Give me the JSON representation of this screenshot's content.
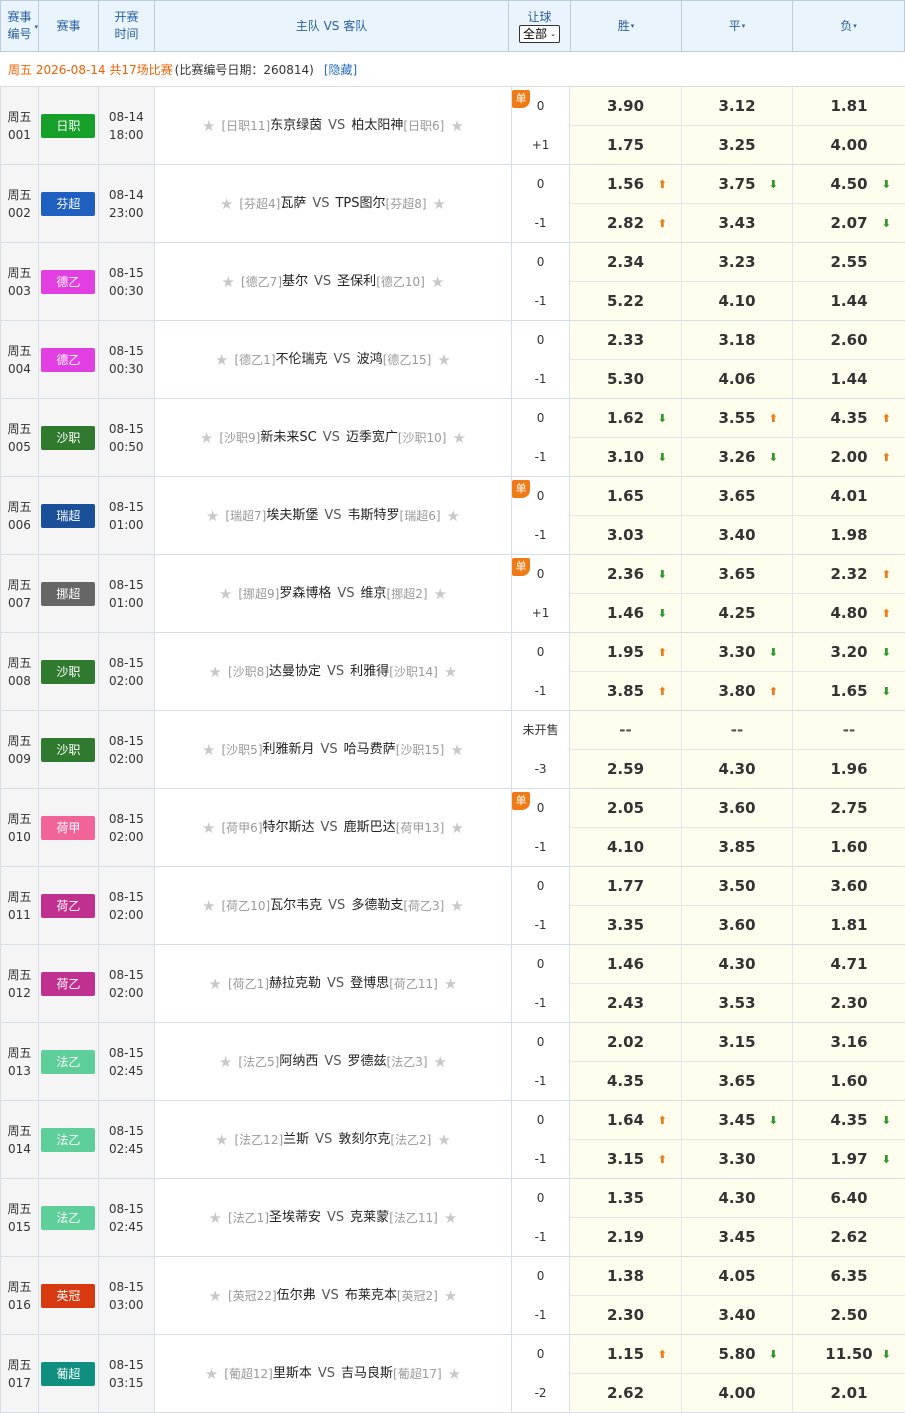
{
  "header": {
    "col_id": "赛事\n编号",
    "col_league": "赛事",
    "col_time": "开赛\n时间",
    "col_match": "主队 VS 客队",
    "col_hc": "让球",
    "hc_select": "全部",
    "col_win": "胜",
    "col_draw": "平",
    "col_lose": "负"
  },
  "info": {
    "prefix": "周五 2026-08-14 共17场比赛",
    "note": "(比赛编号日期：260814)",
    "link": "[隐藏]"
  },
  "vs": "VS",
  "matches": [
    {
      "day": "周五",
      "num": "001",
      "league": "日职",
      "color": "#16a02a",
      "date": "08-14",
      "time": "18:00",
      "hrank": "[日职11]",
      "home": "东京绿茵",
      "away": "柏太阳神",
      "arank": "[日职6]",
      "dan": "单",
      "h1": "0",
      "h2": "+1",
      "o1": [
        "3.90",
        "3.12",
        "1.81"
      ],
      "t1": [
        "",
        "",
        ""
      ],
      "o2": [
        "1.75",
        "3.25",
        "4.00"
      ],
      "t2": [
        "",
        "",
        ""
      ]
    },
    {
      "day": "周五",
      "num": "002",
      "league": "芬超",
      "color": "#1f5fbf",
      "date": "08-14",
      "time": "23:00",
      "hrank": "[芬超4]",
      "home": "瓦萨",
      "away": "TPS图尔",
      "arank": "[芬超8]",
      "dan": "",
      "h1": "0",
      "h2": "-1",
      "o1": [
        "1.56",
        "3.75",
        "4.50"
      ],
      "t1": [
        "up",
        "dn",
        "dn"
      ],
      "o2": [
        "2.82",
        "3.43",
        "2.07"
      ],
      "t2": [
        "up",
        "",
        "dn"
      ]
    },
    {
      "day": "周五",
      "num": "003",
      "league": "德乙",
      "color": "#e23fe2",
      "date": "08-15",
      "time": "00:30",
      "hrank": "[德乙7]",
      "home": "基尔",
      "away": "圣保利",
      "arank": "[德乙10]",
      "dan": "",
      "h1": "0",
      "h2": "-1",
      "o1": [
        "2.34",
        "3.23",
        "2.55"
      ],
      "t1": [
        "",
        "",
        ""
      ],
      "o2": [
        "5.22",
        "4.10",
        "1.44"
      ],
      "t2": [
        "",
        "",
        ""
      ]
    },
    {
      "day": "周五",
      "num": "004",
      "league": "德乙",
      "color": "#e23fe2",
      "date": "08-15",
      "time": "00:30",
      "hrank": "[德乙1]",
      "home": "不伦瑞克",
      "away": "波鸿",
      "arank": "[德乙15]",
      "dan": "",
      "h1": "0",
      "h2": "-1",
      "o1": [
        "2.33",
        "3.18",
        "2.60"
      ],
      "t1": [
        "",
        "",
        ""
      ],
      "o2": [
        "5.30",
        "4.06",
        "1.44"
      ],
      "t2": [
        "",
        "",
        ""
      ]
    },
    {
      "day": "周五",
      "num": "005",
      "league": "沙职",
      "color": "#2f7a2f",
      "date": "08-15",
      "time": "00:50",
      "hrank": "[沙职9]",
      "home": "新未来SC",
      "away": "迈季宽广",
      "arank": "[沙职10]",
      "dan": "",
      "h1": "0",
      "h2": "-1",
      "o1": [
        "1.62",
        "3.55",
        "4.35"
      ],
      "t1": [
        "dn",
        "up",
        "up"
      ],
      "o2": [
        "3.10",
        "3.26",
        "2.00"
      ],
      "t2": [
        "dn",
        "dn",
        "up"
      ]
    },
    {
      "day": "周五",
      "num": "006",
      "league": "瑞超",
      "color": "#1a4f9a",
      "date": "08-15",
      "time": "01:00",
      "hrank": "[瑞超7]",
      "home": "埃夫斯堡",
      "away": "韦斯特罗",
      "arank": "[瑞超6]",
      "dan": "单",
      "h1": "0",
      "h2": "-1",
      "o1": [
        "1.65",
        "3.65",
        "4.01"
      ],
      "t1": [
        "",
        "",
        ""
      ],
      "o2": [
        "3.03",
        "3.40",
        "1.98"
      ],
      "t2": [
        "",
        "",
        ""
      ]
    },
    {
      "day": "周五",
      "num": "007",
      "league": "挪超",
      "color": "#666666",
      "date": "08-15",
      "time": "01:00",
      "hrank": "[挪超9]",
      "home": "罗森博格",
      "away": "维京",
      "arank": "[挪超2]",
      "dan": "单",
      "h1": "0",
      "h2": "+1",
      "o1": [
        "2.36",
        "3.65",
        "2.32"
      ],
      "t1": [
        "dn",
        "",
        "up"
      ],
      "o2": [
        "1.46",
        "4.25",
        "4.80"
      ],
      "t2": [
        "dn",
        "",
        "up"
      ]
    },
    {
      "day": "周五",
      "num": "008",
      "league": "沙职",
      "color": "#2f7a2f",
      "date": "08-15",
      "time": "02:00",
      "hrank": "[沙职8]",
      "home": "达曼协定",
      "away": "利雅得",
      "arank": "[沙职14]",
      "dan": "",
      "h1": "0",
      "h2": "-1",
      "o1": [
        "1.95",
        "3.30",
        "3.20"
      ],
      "t1": [
        "up",
        "dn",
        "dn"
      ],
      "o2": [
        "3.85",
        "3.80",
        "1.65"
      ],
      "t2": [
        "up",
        "up",
        "dn"
      ]
    },
    {
      "day": "周五",
      "num": "009",
      "league": "沙职",
      "color": "#2f7a2f",
      "date": "08-15",
      "time": "02:00",
      "hrank": "[沙职5]",
      "home": "利雅新月",
      "away": "哈马费萨",
      "arank": "[沙职15]",
      "dan": "",
      "h1": "未开售",
      "h2": "-3",
      "o1": [
        "--",
        "--",
        "--"
      ],
      "t1": [
        "",
        "",
        ""
      ],
      "o2": [
        "2.59",
        "4.30",
        "1.96"
      ],
      "t2": [
        "",
        "",
        ""
      ]
    },
    {
      "day": "周五",
      "num": "010",
      "league": "荷甲",
      "color": "#f0649a",
      "date": "08-15",
      "time": "02:00",
      "hrank": "[荷甲6]",
      "home": "特尔斯达",
      "away": "鹿斯巴达",
      "arank": "[荷甲13]",
      "dan": "单",
      "h1": "0",
      "h2": "-1",
      "o1": [
        "2.05",
        "3.60",
        "2.75"
      ],
      "t1": [
        "",
        "",
        ""
      ],
      "o2": [
        "4.10",
        "3.85",
        "1.60"
      ],
      "t2": [
        "",
        "",
        ""
      ]
    },
    {
      "day": "周五",
      "num": "011",
      "league": "荷乙",
      "color": "#c0308f",
      "date": "08-15",
      "time": "02:00",
      "hrank": "[荷乙10]",
      "home": "瓦尔韦克",
      "away": "多德勒支",
      "arank": "[荷乙3]",
      "dan": "",
      "h1": "0",
      "h2": "-1",
      "o1": [
        "1.77",
        "3.50",
        "3.60"
      ],
      "t1": [
        "",
        "",
        ""
      ],
      "o2": [
        "3.35",
        "3.60",
        "1.81"
      ],
      "t2": [
        "",
        "",
        ""
      ]
    },
    {
      "day": "周五",
      "num": "012",
      "league": "荷乙",
      "color": "#c0308f",
      "date": "08-15",
      "time": "02:00",
      "hrank": "[荷乙1]",
      "home": "赫拉克勒",
      "away": "登博思",
      "arank": "[荷乙11]",
      "dan": "",
      "h1": "0",
      "h2": "-1",
      "o1": [
        "1.46",
        "4.30",
        "4.71"
      ],
      "t1": [
        "",
        "",
        ""
      ],
      "o2": [
        "2.43",
        "3.53",
        "2.30"
      ],
      "t2": [
        "",
        "",
        ""
      ]
    },
    {
      "day": "周五",
      "num": "013",
      "league": "法乙",
      "color": "#5fcf9a",
      "date": "08-15",
      "time": "02:45",
      "hrank": "[法乙5]",
      "home": "阿纳西",
      "away": "罗德兹",
      "arank": "[法乙3]",
      "dan": "",
      "h1": "0",
      "h2": "-1",
      "o1": [
        "2.02",
        "3.15",
        "3.16"
      ],
      "t1": [
        "",
        "",
        ""
      ],
      "o2": [
        "4.35",
        "3.65",
        "1.60"
      ],
      "t2": [
        "",
        "",
        ""
      ]
    },
    {
      "day": "周五",
      "num": "014",
      "league": "法乙",
      "color": "#5fcf9a",
      "date": "08-15",
      "time": "02:45",
      "hrank": "[法乙12]",
      "home": "兰斯",
      "away": "敦刻尔克",
      "arank": "[法乙2]",
      "dan": "",
      "h1": "0",
      "h2": "-1",
      "o1": [
        "1.64",
        "3.45",
        "4.35"
      ],
      "t1": [
        "up",
        "dn",
        "dn"
      ],
      "o2": [
        "3.15",
        "3.30",
        "1.97"
      ],
      "t2": [
        "up",
        "",
        "dn"
      ]
    },
    {
      "day": "周五",
      "num": "015",
      "league": "法乙",
      "color": "#5fcf9a",
      "date": "08-15",
      "time": "02:45",
      "hrank": "[法乙1]",
      "home": "圣埃蒂安",
      "away": "克莱蒙",
      "arank": "[法乙11]",
      "dan": "",
      "h1": "0",
      "h2": "-1",
      "o1": [
        "1.35",
        "4.30",
        "6.40"
      ],
      "t1": [
        "",
        "",
        ""
      ],
      "o2": [
        "2.19",
        "3.45",
        "2.62"
      ],
      "t2": [
        "",
        "",
        ""
      ]
    },
    {
      "day": "周五",
      "num": "016",
      "league": "英冠",
      "color": "#d73a10",
      "date": "08-15",
      "time": "03:00",
      "hrank": "[英冠22]",
      "home": "伍尔弗",
      "away": "布莱克本",
      "arank": "[英冠2]",
      "dan": "",
      "h1": "0",
      "h2": "-1",
      "o1": [
        "1.38",
        "4.05",
        "6.35"
      ],
      "t1": [
        "",
        "",
        ""
      ],
      "o2": [
        "2.30",
        "3.40",
        "2.50"
      ],
      "t2": [
        "",
        "",
        ""
      ]
    },
    {
      "day": "周五",
      "num": "017",
      "league": "葡超",
      "color": "#0f8f7f",
      "date": "08-15",
      "time": "03:15",
      "hrank": "[葡超12]",
      "home": "里斯本",
      "away": "吉马良斯",
      "arank": "[葡超17]",
      "dan": "",
      "h1": "0",
      "h2": "-2",
      "o1": [
        "1.15",
        "5.80",
        "11.50"
      ],
      "t1": [
        "up",
        "dn",
        "dn"
      ],
      "o2": [
        "2.62",
        "4.00",
        "2.01"
      ],
      "t2": [
        "",
        "",
        ""
      ]
    }
  ]
}
